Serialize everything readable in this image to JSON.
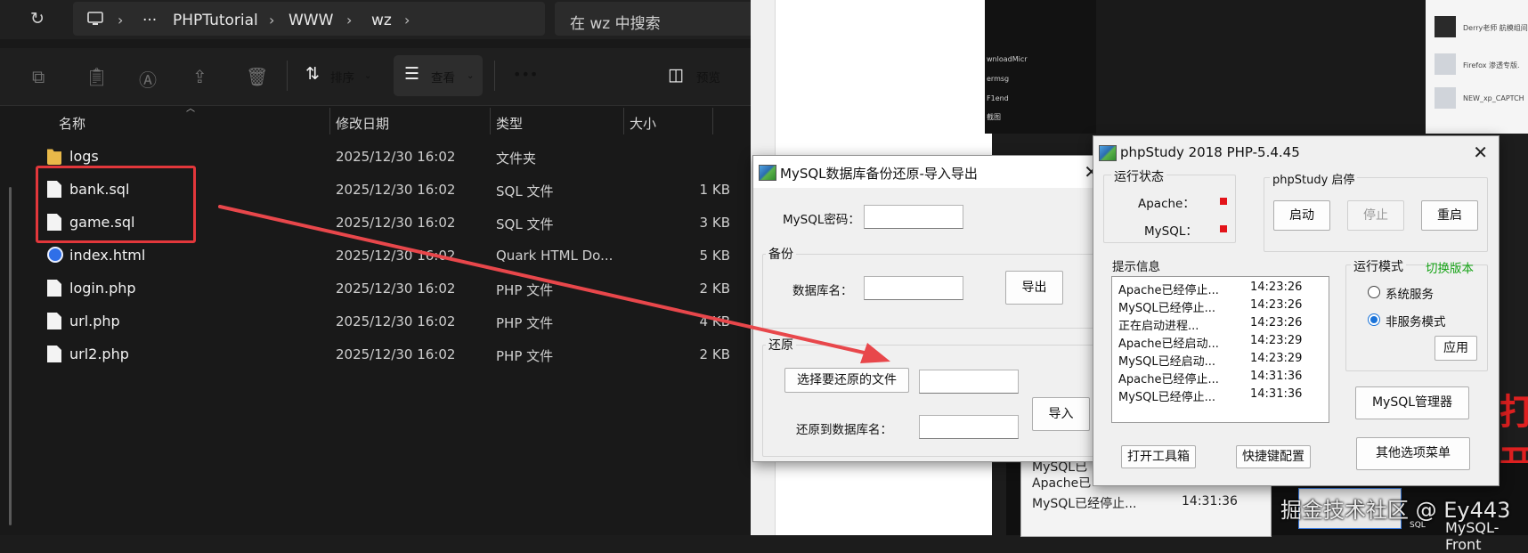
{
  "explorer": {
    "breadcrumb": [
      "···",
      "PHPTutorial",
      "WWW",
      "wz"
    ],
    "search_placeholder": "在 wz 中搜索",
    "toolbar": {
      "sort_label": "排序",
      "view_label": "查看",
      "more_label": "•••",
      "preview_label": "预览"
    },
    "columns": {
      "name": "名称",
      "date": "修改日期",
      "type": "类型",
      "size": "大小"
    },
    "files": [
      {
        "name": "logs",
        "date": "2025/12/30 16:02",
        "type": "文件夹",
        "size": "",
        "icon": "folder-icon"
      },
      {
        "name": "bank.sql",
        "date": "2025/12/30 16:02",
        "type": "SQL 文件",
        "size": "1 KB",
        "icon": "document-icon"
      },
      {
        "name": "game.sql",
        "date": "2025/12/30 16:02",
        "type": "SQL 文件",
        "size": "3 KB",
        "icon": "document-icon"
      },
      {
        "name": "index.html",
        "date": "2025/12/30 16:02",
        "type": "Quark HTML Do...",
        "size": "5 KB",
        "icon": "quark-browser-icon"
      },
      {
        "name": "login.php",
        "date": "2025/12/30 16:02",
        "type": "PHP 文件",
        "size": "2 KB",
        "icon": "document-icon"
      },
      {
        "name": "url.php",
        "date": "2025/12/30 16:02",
        "type": "PHP 文件",
        "size": "4 KB",
        "icon": "document-icon"
      },
      {
        "name": "url2.php",
        "date": "2025/12/30 16:02",
        "type": "PHP 文件",
        "size": "2 KB",
        "icon": "document-icon"
      }
    ]
  },
  "mysql_dialog": {
    "title": "MySQL数据库备份还原-导入导出",
    "password_label": "MySQL密码：",
    "backup_group": "备份",
    "db_name_label": "数据库名：",
    "export_button": "导出",
    "restore_group": "还原",
    "choose_file_button": "选择要还原的文件",
    "restore_db_label": "还原到数据库名：",
    "import_button": "导入"
  },
  "phpstudy": {
    "title": "phpStudy 2018   PHP-5.4.45",
    "status_group": "运行状态",
    "apache_label": "Apache：",
    "mysql_label": "MySQL：",
    "control_group": "phpStudy  启停",
    "start_button": "启动",
    "stop_button": "停止",
    "restart_button": "重启",
    "info_label": "提示信息",
    "logs": [
      {
        "msg": "Apache已经停止...",
        "time": "14:23:26"
      },
      {
        "msg": "MySQL已经停止...",
        "time": "14:23:26"
      },
      {
        "msg": "正在启动进程...",
        "time": "14:23:26"
      },
      {
        "msg": "Apache已经启动...",
        "time": "14:23:29"
      },
      {
        "msg": "MySQL已经启动...",
        "time": "14:23:29"
      },
      {
        "msg": "Apache已经停止...",
        "time": "14:31:36"
      },
      {
        "msg": "MySQL已经停止...",
        "time": "14:31:36"
      }
    ],
    "mode_label": "运行模式",
    "switch_version": "切换版本",
    "mode_system": "系统服务",
    "mode_non_service": "非服务模式",
    "apply_button": "应用",
    "mysql_manager_button": "MySQL管理器",
    "toolbox_button": "打开工具箱",
    "shortcut_button": "快捷键配置",
    "other_menu_button": "其他选项菜单"
  },
  "background": {
    "log_lines": [
      {
        "msg": "MySQL已",
        "time": ""
      },
      {
        "msg": "Apache已",
        "time": ""
      },
      {
        "msg": "MySQL已经停止...",
        "time": "14:31:36"
      }
    ],
    "red_text": "打开",
    "mysql_front": "MySQL-Front",
    "sql_badge": "SQL",
    "dark_list": [
      "wnloadMicr",
      "ermsg",
      "F1end",
      "截图"
    ],
    "thumb_titles": [
      "Derry老师 航模组间",
      "Firefox 渗透专版.",
      "NEW_xp_CAPTCH"
    ],
    "watermark": "掘金技术社区 @ Ey443"
  },
  "colors": {
    "highlight": "#e2373b",
    "status_stopped": "#e3141a",
    "switch_version": "#16a316",
    "radio_selected": "#1a73d9"
  }
}
